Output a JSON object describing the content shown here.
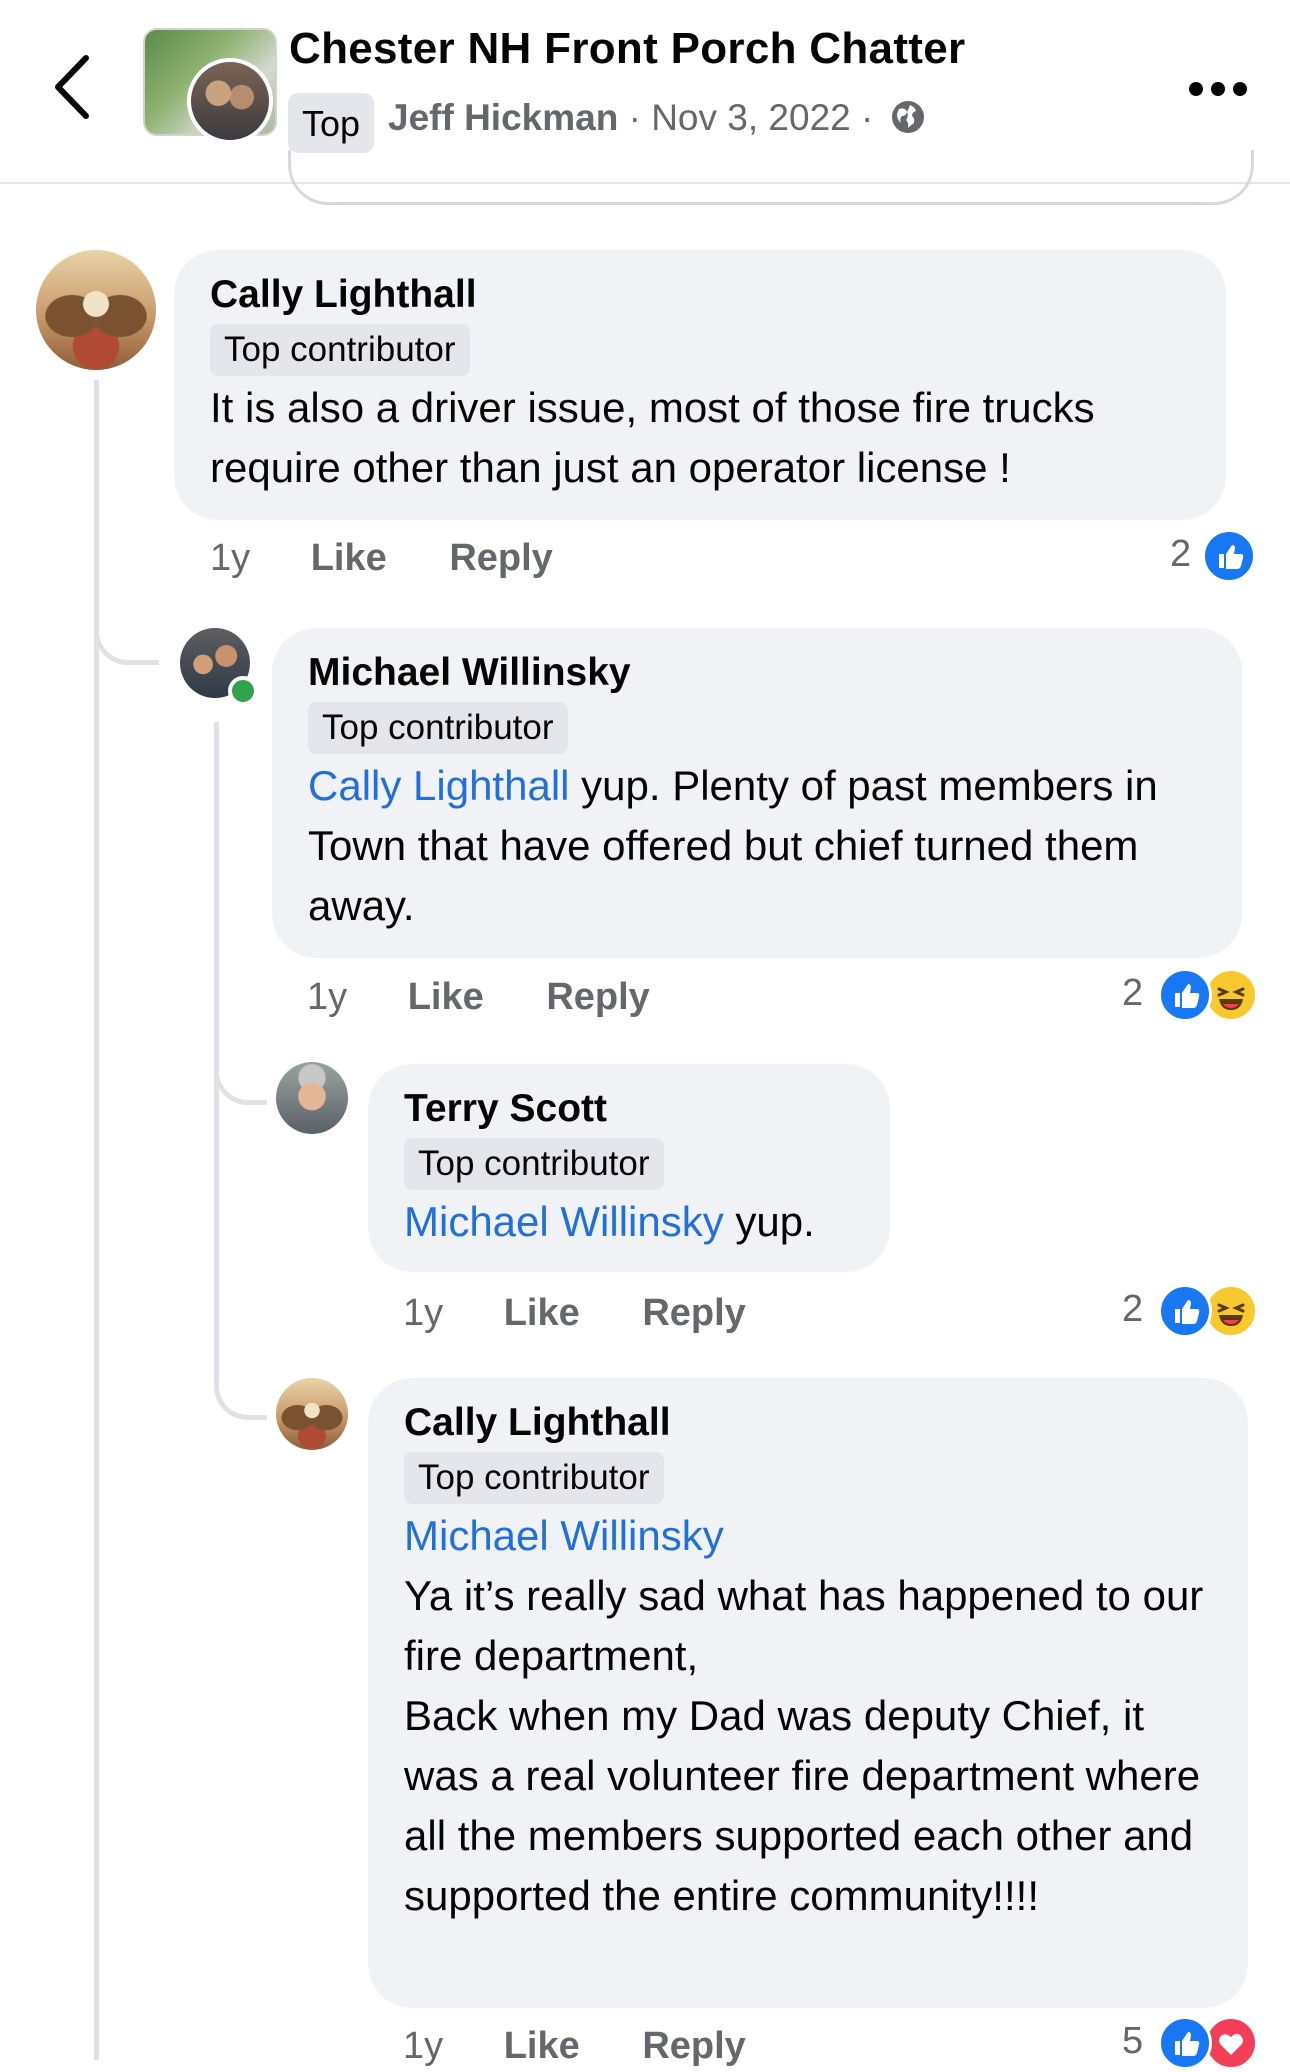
{
  "header": {
    "group_name": "Chester NH Front Porch Chatter",
    "top_badge": "Top",
    "author": "Jeff Hickman",
    "separator": "·",
    "date": "Nov 3, 2022",
    "privacy_icon": "globe-icon",
    "back_icon": "chevron-left-icon",
    "more_icon": "more-horizontal-icon"
  },
  "comments": [
    {
      "author": "Cally Lighthall",
      "badge": "Top contributor",
      "text": "It is also a driver issue, most of those fire trucks require other than just an operator license !",
      "time": "1y",
      "like": "Like",
      "reply": "Reply",
      "reaction_count": "2",
      "reactions": [
        "like-icon"
      ]
    },
    {
      "author": "Michael Willinsky",
      "badge": "Top contributor",
      "mention": "Cally Lighthall",
      "text": " yup.  Plenty of past members in Town that have offered but chief turned them away.",
      "time": "1y",
      "like": "Like",
      "reply": "Reply",
      "reaction_count": "2",
      "reactions": [
        "like-icon",
        "haha-icon"
      ]
    },
    {
      "author": "Terry Scott",
      "badge": "Top contributor",
      "mention": "Michael Willinsky",
      "text": " yup.",
      "time": "1y",
      "like": "Like",
      "reply": "Reply",
      "reaction_count": "2",
      "reactions": [
        "like-icon",
        "haha-icon"
      ]
    },
    {
      "author": "Cally Lighthall",
      "badge": "Top contributor",
      "mention": "Michael Willinsky",
      "text_lines": [
        "Ya it’s really sad what has happened to our fire department,",
        "Back when my Dad was deputy Chief, it was a real volunteer fire department where all the members supported each other and supported the entire community!!!!"
      ],
      "time": "1y",
      "like": "Like",
      "reply": "Reply",
      "reaction_count": "5",
      "reactions": [
        "like-icon",
        "love-icon"
      ]
    }
  ],
  "colors": {
    "mention": "#216fdb",
    "bubble": "#f0f2f5",
    "meta_text": "#65676b",
    "like_reaction": "#1877f2"
  }
}
